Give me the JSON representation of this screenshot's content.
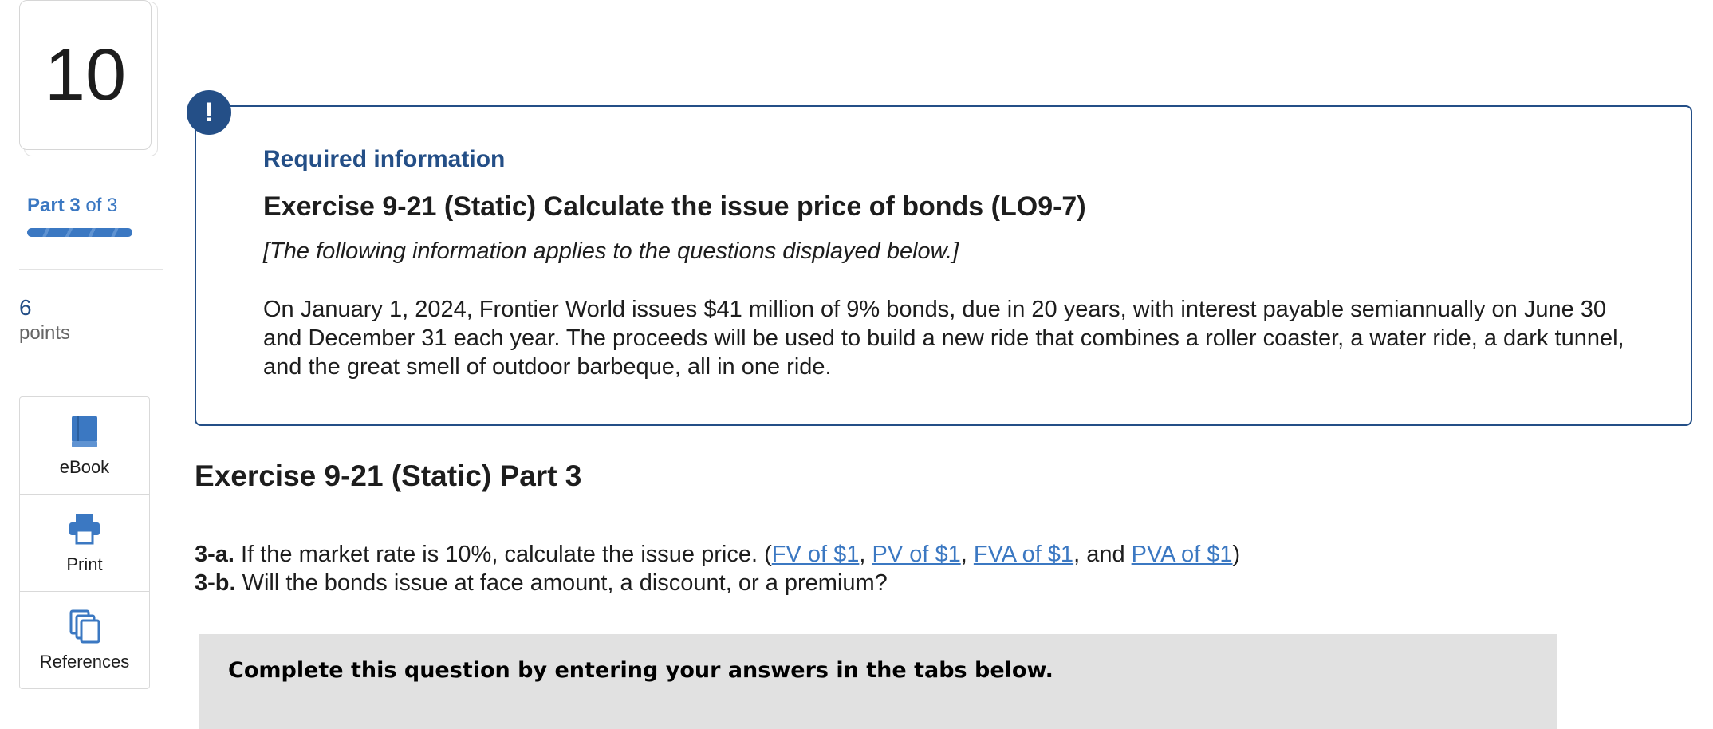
{
  "question": {
    "number": "10"
  },
  "progress": {
    "part_label": "Part 3",
    "of_label": "of 3",
    "fraction_complete": 1.0
  },
  "points": {
    "value": "6",
    "label": "points"
  },
  "tools": [
    {
      "label": "eBook",
      "icon": "book-icon"
    },
    {
      "label": "Print",
      "icon": "printer-icon"
    },
    {
      "label": "References",
      "icon": "copy-icon"
    }
  ],
  "required_info": {
    "alert_symbol": "!",
    "heading": "Required information",
    "exercise_title": "Exercise 9-21 (Static) Calculate the issue price of bonds (LO9-7)",
    "note": "[The following information applies to the questions displayed below.]",
    "body": "On January 1, 2024, Frontier World issues $41 million of 9% bonds, due in 20 years, with interest payable semiannually on June 30 and December 31 each year. The proceeds will be used to build a new ride that combines a roller coaster, a water ride, a dark tunnel, and the great smell of outdoor barbeque, all in one ride."
  },
  "part_heading": "Exercise 9-21 (Static) Part 3",
  "questions": {
    "q3a_label": "3-a.",
    "q3a_text": " If the market rate is 10%, calculate the issue price. (",
    "links": [
      "FV of $1",
      "PV of $1",
      "FVA of $1",
      "PVA of $1"
    ],
    "sep1": ", ",
    "sep2": ", ",
    "sep3": ", and ",
    "close": ")",
    "q3b_label": "3-b.",
    "q3b_text": " Will the bonds issue at face amount, a discount, or a premium?"
  },
  "instructions": "Complete this question by entering your answers in the tabs below.",
  "colors": {
    "navy": "#244f87",
    "link_blue": "#3b78c2",
    "panel_gray": "#e1e1e1"
  }
}
